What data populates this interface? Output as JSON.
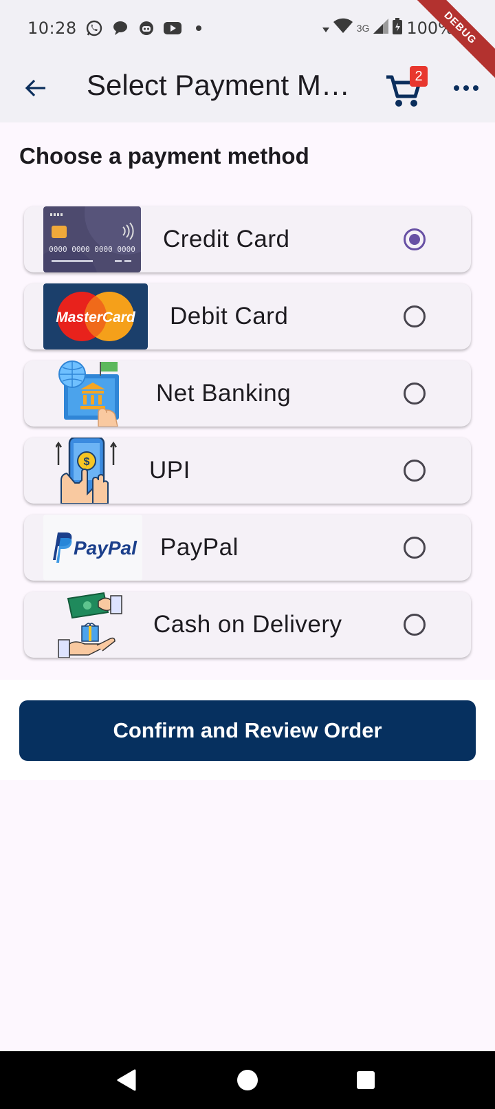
{
  "status_bar": {
    "time": "10:28",
    "network": "3G",
    "battery": "100%",
    "notification_icons": [
      "whatsapp-icon",
      "chat-icon",
      "bot-icon",
      "youtube-icon",
      "dot-icon"
    ]
  },
  "debug_banner": "DEBUG",
  "app_bar": {
    "title": "Select Payment Method",
    "cart_count": "2"
  },
  "section_title": "Choose a payment method",
  "payment_methods": [
    {
      "label": "Credit Card",
      "selected": true,
      "icon": "credit-card-image"
    },
    {
      "label": "Debit Card",
      "selected": false,
      "icon": "mastercard-image"
    },
    {
      "label": "Net Banking",
      "selected": false,
      "icon": "net-banking-image"
    },
    {
      "label": "UPI",
      "selected": false,
      "icon": "upi-image"
    },
    {
      "label": "PayPal",
      "selected": false,
      "icon": "paypal-image"
    },
    {
      "label": "Cash on Delivery",
      "selected": false,
      "icon": "cash-delivery-image"
    }
  ],
  "card_text": {
    "credit_card_number": "0000 0000 0000 0000",
    "mastercard_logo": "MasterCard",
    "paypal_logo": "PayPal"
  },
  "confirm_button": "Confirm and Review Order",
  "colors": {
    "primary": "#06305f",
    "radio_selected": "#6750a4",
    "badge": "#e8372e",
    "card_bg": "#f5f1f7",
    "page_bg": "#fdf7fe"
  }
}
